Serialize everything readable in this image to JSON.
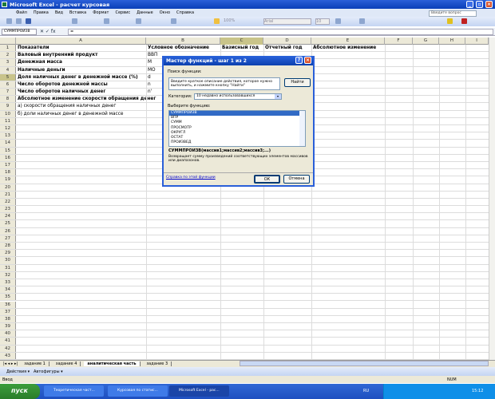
{
  "window": {
    "title": "Microsoft Excel - расчет курсовая"
  },
  "menu": [
    "Файл",
    "Правка",
    "Вид",
    "Вставка",
    "Формат",
    "Сервис",
    "Данные",
    "Окно",
    "Справка"
  ],
  "help_placeholder": "Введите вопрос",
  "toolbar": {
    "zoom": "100%",
    "font": "Arial",
    "size": "10"
  },
  "formula_bar": {
    "name_box": "СУММПРОИЗВ",
    "fx": "✕ ✓ fx",
    "value": "="
  },
  "columns": [
    "A",
    "B",
    "C",
    "D",
    "E",
    "F",
    "G",
    "H",
    "I"
  ],
  "rows": [
    {
      "n": "1",
      "a": "Показатели",
      "b": "Условное обозначение",
      "c": "Базисный год",
      "d": "Отчетный год",
      "e": "Абсолютное изменение",
      "bold": true
    },
    {
      "n": "2",
      "a": "Валовый внутренний продукт",
      "b": "ВВП",
      "bold": true
    },
    {
      "n": "3",
      "a": "Денежная масса",
      "b": "М",
      "bold": true
    },
    {
      "n": "4",
      "a": "Наличные деньги",
      "b": "МО",
      "bold": true
    },
    {
      "n": "5",
      "a": "Доля наличных денег в денежной массе (%)",
      "b": "d",
      "bold": true
    },
    {
      "n": "6",
      "a": "Число оборотов денежной массы",
      "b": "n",
      "bold": true
    },
    {
      "n": "7",
      "a": "Число оборотов наличных денег",
      "b": "n'",
      "bold": true
    },
    {
      "n": "8",
      "a": "    Абсолютное изменение скорости обращения денег",
      "bold": true
    },
    {
      "n": "9",
      "a": "а) скорости обращения наличных денег"
    },
    {
      "n": "10",
      "a": "б) доли наличных денег в денежной массе"
    }
  ],
  "row_count": 43,
  "sheet_tabs": [
    "задание 1",
    "задание 4",
    "аналитическая часть",
    "задание 3"
  ],
  "active_tab": 2,
  "draw_toolbar": {
    "actions": "Действия ▾",
    "autoshapes": "Автофигуры ▾"
  },
  "status": {
    "left": "Ввод",
    "num": "NUM"
  },
  "taskbar": {
    "start": "пуск",
    "tasks": [
      "Теоретическая част...",
      "Курсовая по статис...",
      "Microsoft Excel - рас..."
    ],
    "lang": "RU",
    "clock": "15:12"
  },
  "dialog": {
    "title": "Мастер функций - шаг 1 из 2",
    "search_label": "Поиск функции:",
    "search_text": "Введите краткое описание действия, которое нужно выполнить, и нажмите кнопку \"Найти\"",
    "find_button": "Найти",
    "category_label": "Категория:",
    "category_value": "10 недавно использовавшихся",
    "choose_label": "Выберите функцию:",
    "functions": [
      "СУММПРОИЗВ",
      "ВПР",
      "СУММ",
      "ПРОСМОТР",
      "ОКРУГЛ",
      "ОСТАТ",
      "ПРОИЗВЕД"
    ],
    "selected_index": 0,
    "signature": "СУММПРОИЗВ(массив1;массив2;массив3;...)",
    "description": "Возвращает сумму произведений соответствующих элементов массивов или диапазонов.",
    "help_link": "Справка по этой функции",
    "ok": "ОК",
    "cancel": "Отмена"
  }
}
